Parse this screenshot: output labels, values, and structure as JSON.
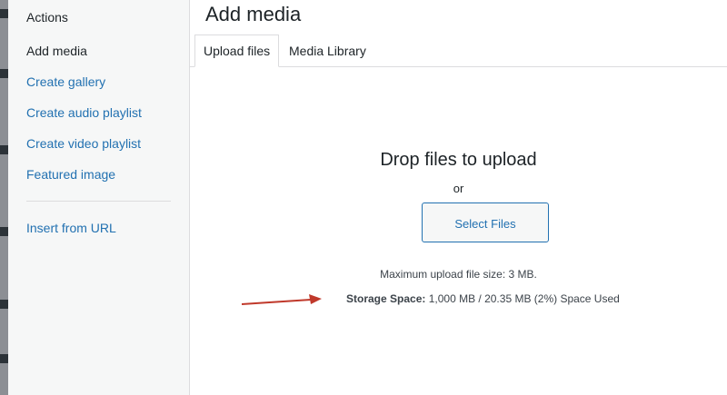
{
  "sidebar": {
    "heading": "Actions",
    "items": [
      {
        "label": "Add media",
        "active": true
      },
      {
        "label": "Create gallery",
        "active": false
      },
      {
        "label": "Create audio playlist",
        "active": false
      },
      {
        "label": "Create video playlist",
        "active": false
      },
      {
        "label": "Featured image",
        "active": false
      }
    ],
    "secondary": [
      {
        "label": "Insert from URL"
      }
    ]
  },
  "main": {
    "title": "Add media",
    "tabs": [
      {
        "label": "Upload files",
        "active": true
      },
      {
        "label": "Media Library",
        "active": false
      }
    ],
    "uploader": {
      "drop_title": "Drop files to upload",
      "or_text": "or",
      "select_button": "Select Files",
      "max_size": "Maximum upload file size: 3 MB.",
      "storage_label": "Storage Space:",
      "storage_value": "1,000 MB / 20.35 MB (2%) Space Used"
    }
  },
  "colors": {
    "link": "#2271b1",
    "annotation_arrow": "#c0392b"
  }
}
